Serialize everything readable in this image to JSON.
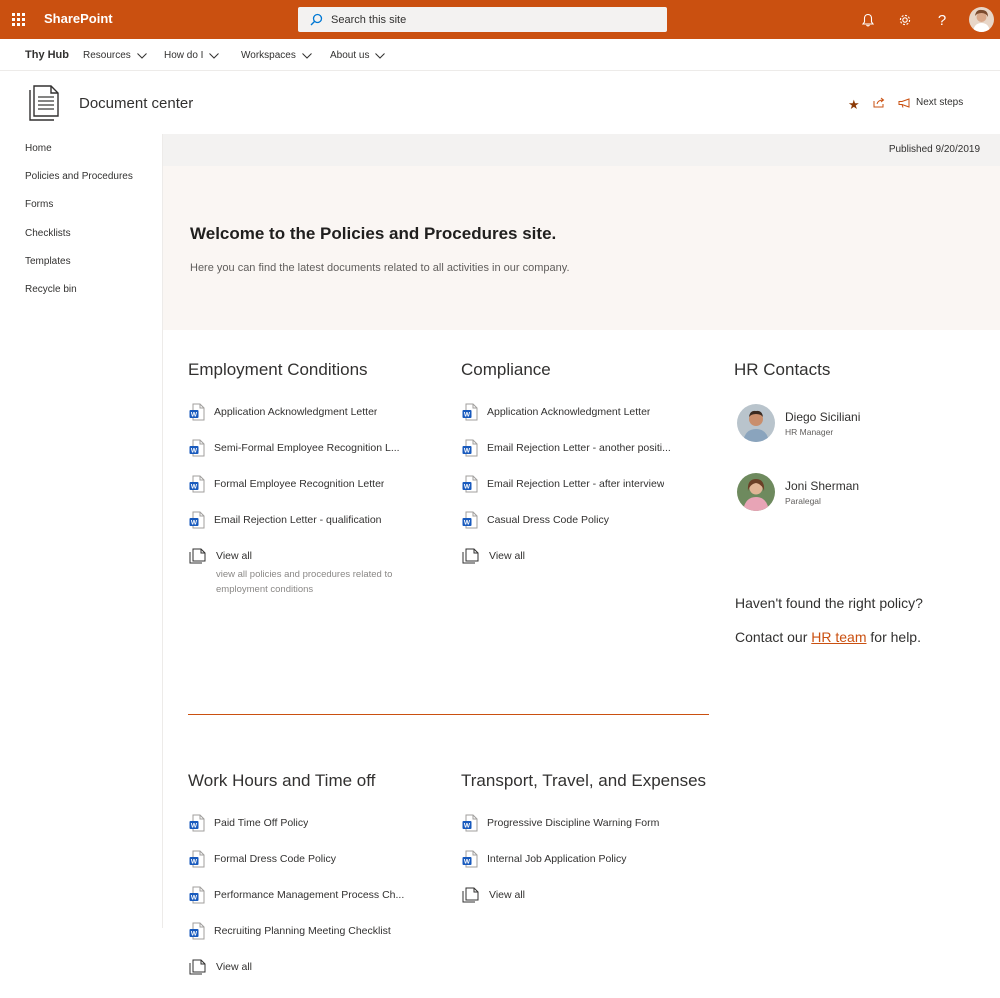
{
  "suite": {
    "app_name": "SharePoint",
    "search_placeholder": "Search this site",
    "icons": [
      "app-launcher-icon",
      "bell-icon",
      "gear-icon",
      "help-icon"
    ]
  },
  "hub": {
    "title": "Thy Hub",
    "items": [
      {
        "label": "Resources"
      },
      {
        "label": "How do I"
      },
      {
        "label": "Workspaces"
      },
      {
        "label": "About us"
      }
    ]
  },
  "site": {
    "title": "Document center",
    "actions": {
      "next_steps": "Next steps"
    }
  },
  "leftnav": {
    "items": [
      {
        "label": "Home"
      },
      {
        "label": "Policies and Procedures"
      },
      {
        "label": "Forms"
      },
      {
        "label": "Checklists"
      },
      {
        "label": "Templates"
      },
      {
        "label": "Recycle bin"
      }
    ]
  },
  "page": {
    "published": "Published 9/20/2019",
    "hero_title": "Welcome to the Policies and Procedures site.",
    "hero_subtitle": "Here you can find the latest documents related to all activities in our company."
  },
  "sections": {
    "employment": {
      "title": "Employment Conditions",
      "docs": [
        "Application Acknowledgment Letter",
        "Semi-Formal Employee Recognition L...",
        "Formal Employee Recognition Letter",
        "Email Rejection Letter - qualification"
      ],
      "view_all": "View all",
      "view_all_desc": "view all policies and procedures related to employment conditions"
    },
    "compliance": {
      "title": "Compliance",
      "docs": [
        "Application Acknowledgment Letter",
        "Email Rejection Letter - another positi...",
        "Email Rejection Letter - after interview",
        "Casual Dress Code Policy"
      ],
      "view_all": "View all"
    },
    "work_hours": {
      "title": "Work Hours and Time off",
      "docs": [
        "Paid Time Off Policy",
        "Formal Dress Code Policy",
        "Performance Management Process Ch...",
        "Recruiting Planning Meeting Checklist"
      ],
      "view_all": "View all"
    },
    "transport": {
      "title": "Transport, Travel, and Expenses",
      "docs": [
        "Progressive Discipline Warning Form",
        "Internal Job Application Policy"
      ],
      "view_all": "View all"
    }
  },
  "hr_contacts": {
    "title": "HR Contacts",
    "people": [
      {
        "name": "Diego Siciliani",
        "role": "HR Manager"
      },
      {
        "name": "Joni Sherman",
        "role": "Paralegal"
      }
    ],
    "help_line1": "Haven't found the right policy?",
    "help_prefix": "Contact our ",
    "help_link": "HR team",
    "help_suffix": " for help."
  },
  "colors": {
    "accent": "#ca5010",
    "word_blue": "#185abd"
  }
}
